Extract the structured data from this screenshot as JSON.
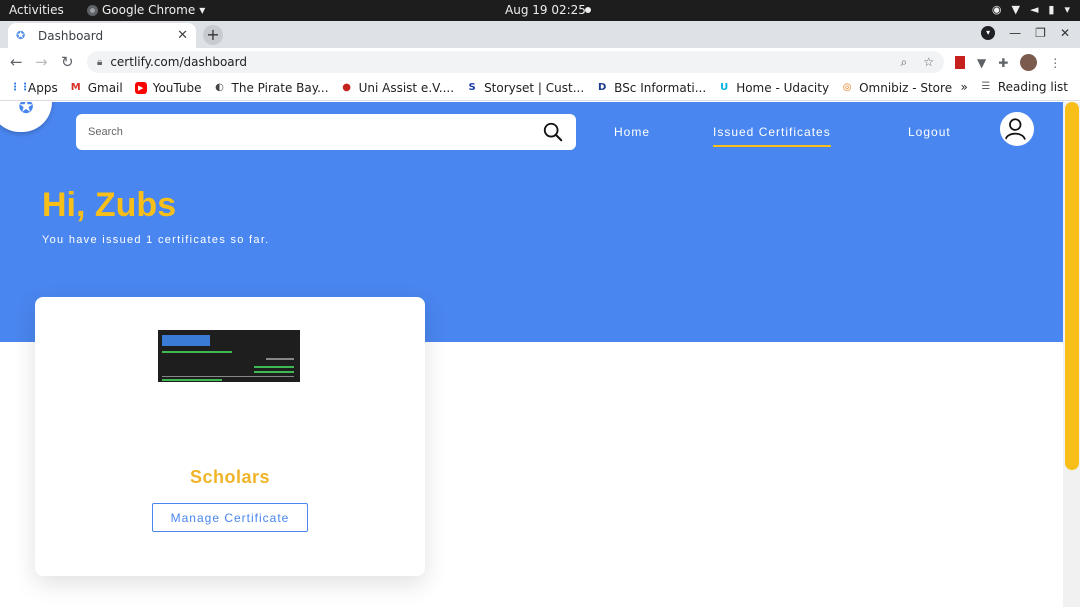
{
  "os": {
    "activities": "Activities",
    "app_name": "Google Chrome",
    "clock": "Aug 19  02:25"
  },
  "browser": {
    "tab_title": "Dashboard",
    "url": "certlify.com/dashboard",
    "bookmarks": [
      {
        "label": "Apps",
        "icon": "apps-grid-icon"
      },
      {
        "label": "Gmail",
        "icon": "gmail-icon"
      },
      {
        "label": "YouTube",
        "icon": "youtube-icon"
      },
      {
        "label": "The Pirate Bay...",
        "icon": "pirate-bay-icon"
      },
      {
        "label": "Uni Assist e.V....",
        "icon": "uni-assist-icon"
      },
      {
        "label": "Storyset | Cust...",
        "icon": "storyset-icon"
      },
      {
        "label": "BSc Informati...",
        "icon": "d-icon"
      },
      {
        "label": "Home - Udacity",
        "icon": "udacity-icon"
      },
      {
        "label": "Omnibiz - Store",
        "icon": "omnibiz-icon"
      }
    ],
    "overflow": "»",
    "reading_list": "Reading list"
  },
  "app": {
    "search_placeholder": "Search",
    "nav": {
      "home": "Home",
      "issued": "Issued Certificates",
      "logout": "Logout"
    },
    "greeting": "Hi, Zubs",
    "subtitle": "You have issued 1 certificates so far.",
    "card": {
      "title": "Scholars",
      "button": "Manage Certificate"
    }
  },
  "colors": {
    "brand_blue": "#4a86ef",
    "accent_yellow": "#f8bf19"
  }
}
